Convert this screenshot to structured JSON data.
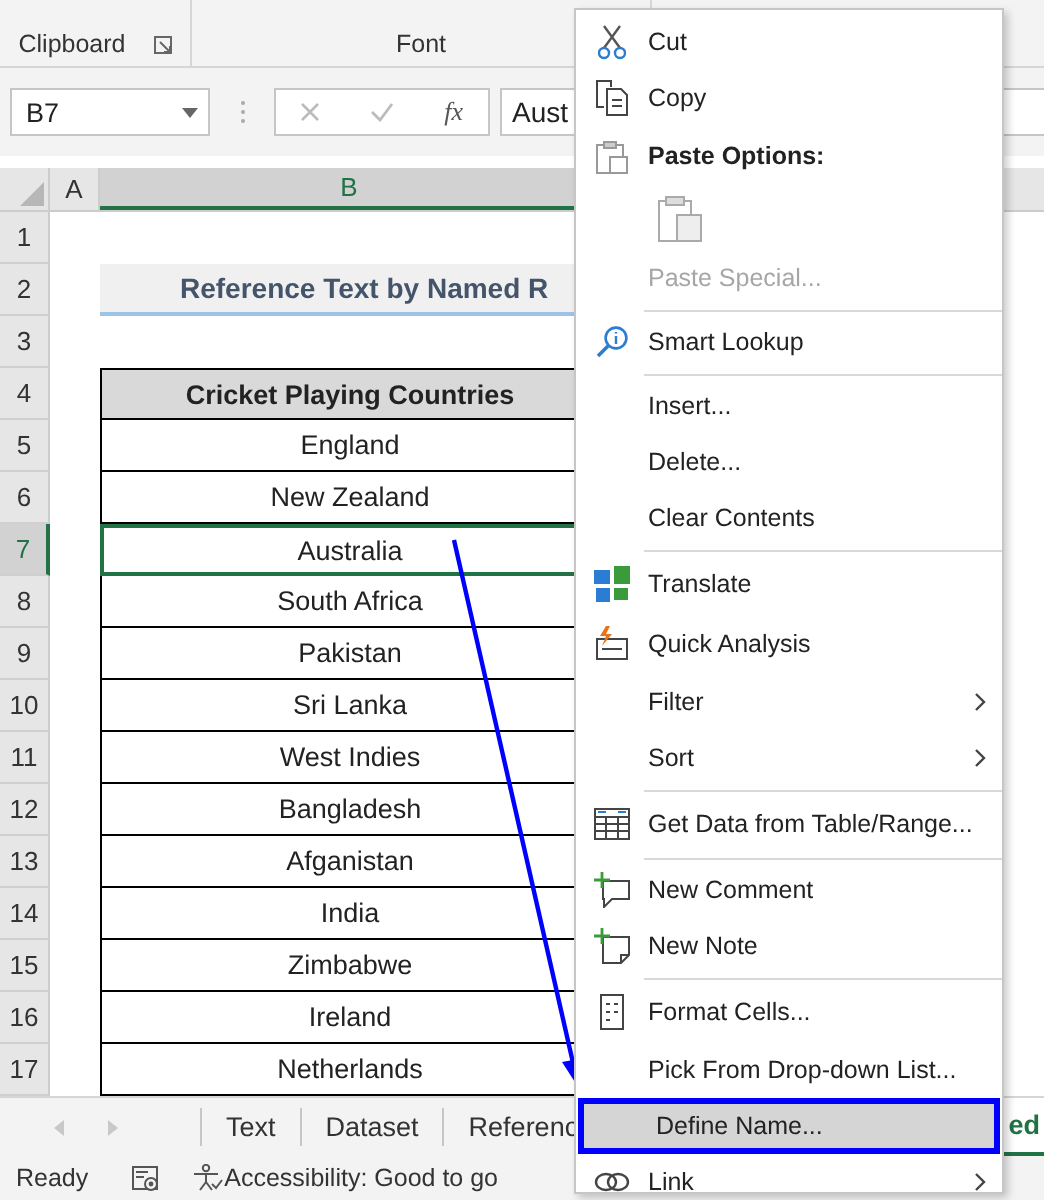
{
  "ribbon": {
    "groups": [
      {
        "label": "Clipboard",
        "launcher": true
      },
      {
        "label": "Font",
        "launcher": false
      }
    ]
  },
  "formula_bar": {
    "name_box": "B7",
    "function_label": "fx",
    "value": "Aust"
  },
  "columns": [
    {
      "label": "A",
      "selected": false
    },
    {
      "label": "B",
      "selected": true
    }
  ],
  "rows": [
    {
      "number": "1",
      "selected": false,
      "kind": "blank"
    },
    {
      "number": "2",
      "selected": false,
      "kind": "title",
      "text": "Reference Text by Named R"
    },
    {
      "number": "3",
      "selected": false,
      "kind": "blank"
    },
    {
      "number": "4",
      "selected": false,
      "kind": "header",
      "text": "Cricket Playing Countries"
    },
    {
      "number": "5",
      "selected": false,
      "kind": "cell",
      "text": "England"
    },
    {
      "number": "6",
      "selected": false,
      "kind": "cell",
      "text": "New Zealand"
    },
    {
      "number": "7",
      "selected": true,
      "kind": "cell",
      "text": "Australia"
    },
    {
      "number": "8",
      "selected": false,
      "kind": "cell",
      "text": "South Africa"
    },
    {
      "number": "9",
      "selected": false,
      "kind": "cell",
      "text": "Pakistan"
    },
    {
      "number": "10",
      "selected": false,
      "kind": "cell",
      "text": "Sri Lanka"
    },
    {
      "number": "11",
      "selected": false,
      "kind": "cell",
      "text": "West Indies"
    },
    {
      "number": "12",
      "selected": false,
      "kind": "cell",
      "text": "Bangladesh"
    },
    {
      "number": "13",
      "selected": false,
      "kind": "cell",
      "text": "Afganistan"
    },
    {
      "number": "14",
      "selected": false,
      "kind": "cell",
      "text": "India"
    },
    {
      "number": "15",
      "selected": false,
      "kind": "cell",
      "text": "Zimbabwe"
    },
    {
      "number": "16",
      "selected": false,
      "kind": "cell",
      "text": "Ireland"
    },
    {
      "number": "17",
      "selected": false,
      "kind": "cell",
      "text": "Netherlands"
    }
  ],
  "sheet_tabs": [
    {
      "label": "Text",
      "selected": false
    },
    {
      "label": "Dataset",
      "selected": false
    },
    {
      "label": "Referenc",
      "selected": false
    },
    {
      "label": "ed",
      "selected": true
    }
  ],
  "status_bar": {
    "mode": "Ready",
    "accessibility": "Accessibility: Good to go"
  },
  "context_menu": {
    "items": [
      {
        "kind": "item",
        "label": "Cut",
        "disabled": false,
        "selected": false,
        "submenu": false
      },
      {
        "kind": "item",
        "label": "Copy",
        "disabled": false,
        "selected": false,
        "submenu": false
      },
      {
        "kind": "heading",
        "label": "Paste Options:"
      },
      {
        "kind": "paste_buttons"
      },
      {
        "kind": "item",
        "label": "Paste Special...",
        "disabled": true,
        "selected": false,
        "submenu": false
      },
      {
        "kind": "separator"
      },
      {
        "kind": "item",
        "label": "Smart Lookup",
        "disabled": false,
        "selected": false,
        "submenu": false
      },
      {
        "kind": "separator"
      },
      {
        "kind": "item",
        "label": "Insert...",
        "disabled": false,
        "selected": false,
        "submenu": false
      },
      {
        "kind": "item",
        "label": "Delete...",
        "disabled": false,
        "selected": false,
        "submenu": false
      },
      {
        "kind": "item",
        "label": "Clear Contents",
        "disabled": false,
        "selected": false,
        "submenu": false
      },
      {
        "kind": "separator"
      },
      {
        "kind": "item",
        "label": "Translate",
        "disabled": false,
        "selected": false,
        "submenu": false
      },
      {
        "kind": "item",
        "label": "Quick Analysis",
        "disabled": false,
        "selected": false,
        "submenu": false
      },
      {
        "kind": "item",
        "label": "Filter",
        "disabled": false,
        "selected": false,
        "submenu": true
      },
      {
        "kind": "item",
        "label": "Sort",
        "disabled": false,
        "selected": false,
        "submenu": true
      },
      {
        "kind": "separator"
      },
      {
        "kind": "item",
        "label": "Get Data from Table/Range...",
        "disabled": false,
        "selected": false,
        "submenu": false
      },
      {
        "kind": "separator"
      },
      {
        "kind": "item",
        "label": "New Comment",
        "disabled": false,
        "selected": false,
        "submenu": false
      },
      {
        "kind": "item",
        "label": "New Note",
        "disabled": false,
        "selected": false,
        "submenu": false
      },
      {
        "kind": "separator"
      },
      {
        "kind": "item",
        "label": "Format Cells...",
        "disabled": false,
        "selected": false,
        "submenu": false
      },
      {
        "kind": "item",
        "label": "Pick From Drop-down List...",
        "disabled": false,
        "selected": false,
        "submenu": false
      },
      {
        "kind": "item",
        "label": "Define Name...",
        "disabled": false,
        "selected": true,
        "submenu": false
      },
      {
        "kind": "item",
        "label": "Link",
        "disabled": false,
        "selected": false,
        "submenu": true
      }
    ]
  }
}
